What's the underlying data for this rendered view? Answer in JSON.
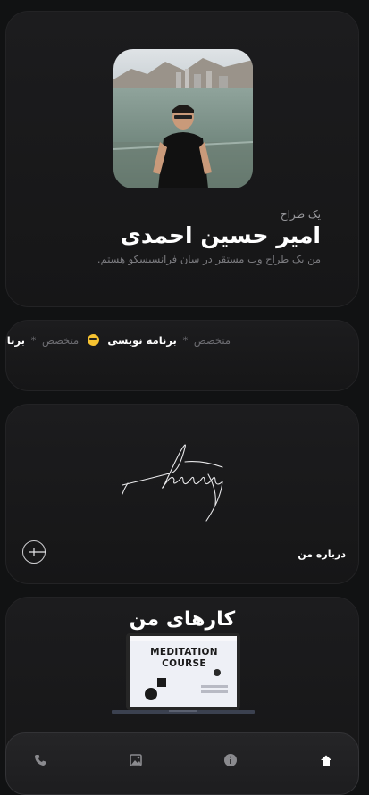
{
  "profile": {
    "role": "یک طراح",
    "name": "امیر حسین احمدی",
    "bio": "من یک طراح وب مستقر در سان فرانسیسکو هستم."
  },
  "marquee": {
    "items": [
      {
        "text": "متخصص",
        "style": "grey"
      },
      {
        "text": "*",
        "style": "star"
      },
      {
        "text": "برنامه نویسی",
        "style": "bold"
      },
      {
        "text": "sunglasses-emoji",
        "style": "emoji"
      },
      {
        "text": "متخصص",
        "style": "grey"
      },
      {
        "text": "*",
        "style": "star"
      },
      {
        "text": "برنامه نویس",
        "style": "bold"
      }
    ]
  },
  "about": {
    "label": "درباره من",
    "button_icon": "plus-circle-icon"
  },
  "works": {
    "title": "کارهای من",
    "preview_heading": "MEDITATION COURSE"
  },
  "nav": {
    "items": [
      {
        "icon": "home-icon",
        "active": true
      },
      {
        "icon": "info-icon",
        "active": false
      },
      {
        "icon": "gallery-icon",
        "active": false
      },
      {
        "icon": "phone-icon",
        "active": false
      }
    ]
  },
  "colors": {
    "background": "#111213",
    "card": "#1c1c1e",
    "muted_text": "#7c7c80",
    "accent_emoji": "#f7c331"
  }
}
